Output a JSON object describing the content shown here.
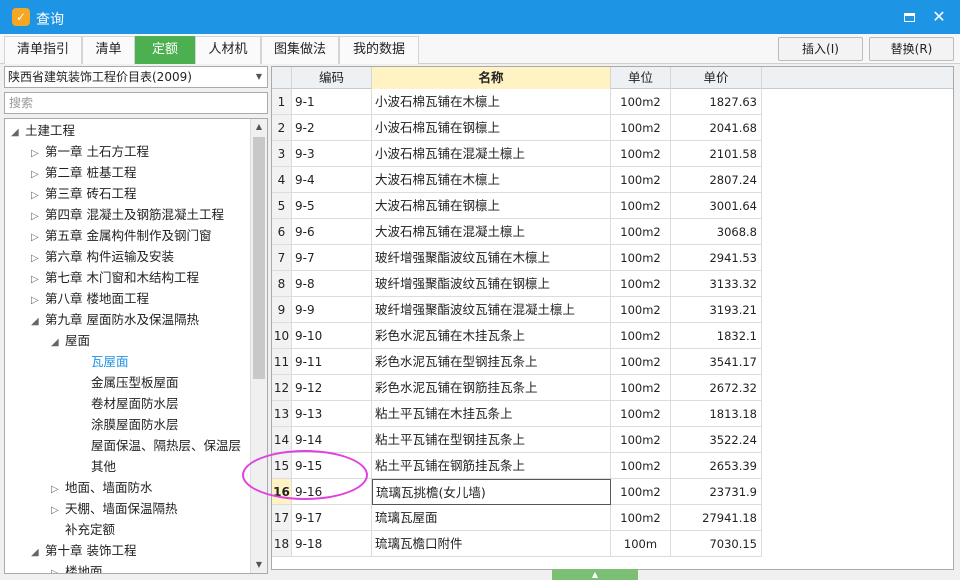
{
  "window": {
    "title": "查询"
  },
  "tabs": [
    {
      "label": "清单指引"
    },
    {
      "label": "清单"
    },
    {
      "label": "定额",
      "active": true
    },
    {
      "label": "人材机"
    },
    {
      "label": "图集做法"
    },
    {
      "label": "我的数据"
    }
  ],
  "actions": {
    "insert": "插入(I)",
    "replace": "替换(R)"
  },
  "selector": {
    "value": "陕西省建筑装饰工程价目表(2009)"
  },
  "search": {
    "placeholder": "搜索"
  },
  "tree": [
    {
      "label": "土建工程",
      "level": 0,
      "state": "expanded"
    },
    {
      "label": "第一章 土石方工程",
      "level": 1,
      "state": "collapsed"
    },
    {
      "label": "第二章 桩基工程",
      "level": 1,
      "state": "collapsed"
    },
    {
      "label": "第三章 砖石工程",
      "level": 1,
      "state": "collapsed"
    },
    {
      "label": "第四章 混凝土及钢筋混凝土工程",
      "level": 1,
      "state": "collapsed"
    },
    {
      "label": "第五章 金属构件制作及钢门窗",
      "level": 1,
      "state": "collapsed"
    },
    {
      "label": "第六章 构件运输及安装",
      "level": 1,
      "state": "collapsed"
    },
    {
      "label": "第七章 木门窗和木结构工程",
      "level": 1,
      "state": "collapsed"
    },
    {
      "label": "第八章 楼地面工程",
      "level": 1,
      "state": "collapsed"
    },
    {
      "label": "第九章 屋面防水及保温隔热",
      "level": 1,
      "state": "expanded"
    },
    {
      "label": "屋面",
      "level": 2,
      "state": "expanded"
    },
    {
      "label": "瓦屋面",
      "level": 3,
      "state": "leaf",
      "selected": true
    },
    {
      "label": "金属压型板屋面",
      "level": 3,
      "state": "leaf"
    },
    {
      "label": "卷材屋面防水层",
      "level": 3,
      "state": "leaf"
    },
    {
      "label": "涂膜屋面防水层",
      "level": 3,
      "state": "leaf"
    },
    {
      "label": "屋面保温、隔热层、保温层",
      "level": 3,
      "state": "leaf"
    },
    {
      "label": "其他",
      "level": 3,
      "state": "leaf"
    },
    {
      "label": "地面、墙面防水",
      "level": 2,
      "state": "collapsed"
    },
    {
      "label": "天棚、墙面保温隔热",
      "level": 2,
      "state": "collapsed"
    },
    {
      "label": "补充定额",
      "level": 2,
      "state": "leaf"
    },
    {
      "label": "第十章 装饰工程",
      "level": 1,
      "state": "expanded"
    },
    {
      "label": "楼地面",
      "level": 2,
      "state": "collapsed"
    }
  ],
  "grid": {
    "headers": {
      "code": "编码",
      "name": "名称",
      "unit": "单位",
      "price": "单价"
    },
    "current_row": 16,
    "rows": [
      {
        "n": "1",
        "code": "9-1",
        "name": "小波石棉瓦铺在木檩上",
        "unit": "100m2",
        "price": "1827.63"
      },
      {
        "n": "2",
        "code": "9-2",
        "name": "小波石棉瓦铺在钢檩上",
        "unit": "100m2",
        "price": "2041.68"
      },
      {
        "n": "3",
        "code": "9-3",
        "name": "小波石棉瓦铺在混凝土檩上",
        "unit": "100m2",
        "price": "2101.58"
      },
      {
        "n": "4",
        "code": "9-4",
        "name": "大波石棉瓦铺在木檩上",
        "unit": "100m2",
        "price": "2807.24"
      },
      {
        "n": "5",
        "code": "9-5",
        "name": "大波石棉瓦铺在钢檩上",
        "unit": "100m2",
        "price": "3001.64"
      },
      {
        "n": "6",
        "code": "9-6",
        "name": "大波石棉瓦铺在混凝土檩上",
        "unit": "100m2",
        "price": "3068.8"
      },
      {
        "n": "7",
        "code": "9-7",
        "name": "玻纤增强聚酯波纹瓦铺在木檩上",
        "unit": "100m2",
        "price": "2941.53"
      },
      {
        "n": "8",
        "code": "9-8",
        "name": "玻纤增强聚酯波纹瓦铺在钢檩上",
        "unit": "100m2",
        "price": "3133.32"
      },
      {
        "n": "9",
        "code": "9-9",
        "name": "玻纤增强聚酯波纹瓦铺在混凝土檩上",
        "unit": "100m2",
        "price": "3193.21"
      },
      {
        "n": "10",
        "code": "9-10",
        "name": "彩色水泥瓦铺在木挂瓦条上",
        "unit": "100m2",
        "price": "1832.1"
      },
      {
        "n": "11",
        "code": "9-11",
        "name": "彩色水泥瓦铺在型钢挂瓦条上",
        "unit": "100m2",
        "price": "3541.17"
      },
      {
        "n": "12",
        "code": "9-12",
        "name": "彩色水泥瓦铺在钢筋挂瓦条上",
        "unit": "100m2",
        "price": "2672.32"
      },
      {
        "n": "13",
        "code": "9-13",
        "name": "粘土平瓦铺在木挂瓦条上",
        "unit": "100m2",
        "price": "1813.18"
      },
      {
        "n": "14",
        "code": "9-14",
        "name": "粘土平瓦铺在型钢挂瓦条上",
        "unit": "100m2",
        "price": "3522.24"
      },
      {
        "n": "15",
        "code": "9-15",
        "name": "粘土平瓦铺在钢筋挂瓦条上",
        "unit": "100m2",
        "price": "2653.39"
      },
      {
        "n": "16",
        "code": "9-16",
        "name": "琉璃瓦挑檐(女儿墙)",
        "unit": "100m2",
        "price": "23731.9"
      },
      {
        "n": "17",
        "code": "9-17",
        "name": "琉璃瓦屋面",
        "unit": "100m2",
        "price": "27941.18"
      },
      {
        "n": "18",
        "code": "9-18",
        "name": "琉璃瓦檐口附件",
        "unit": "100m",
        "price": "7030.15"
      }
    ]
  },
  "colors": {
    "titlebar": "#1e94e4",
    "active_tab": "#4caf50",
    "header_highlight": "#fff3c4",
    "annotation": "#e040e0"
  }
}
